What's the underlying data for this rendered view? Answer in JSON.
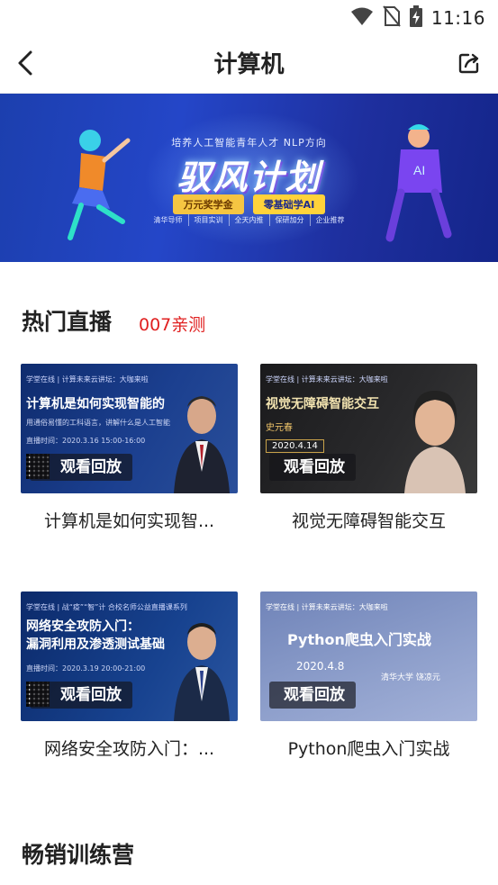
{
  "status_bar": {
    "time": "11:16",
    "icons": [
      "wifi-icon",
      "no-sim-icon",
      "battery-charging-icon"
    ]
  },
  "app_bar": {
    "title": "计算机",
    "back_icon": "chevron-left-icon",
    "share_icon": "share-icon"
  },
  "banner": {
    "subtitle": "培养人工智能青年人才 NLP方向",
    "title": "驭风计划",
    "badge_prize": "万元奖学金",
    "badge_free": "零基础学AI",
    "tags": [
      "清华导师",
      "项目实训",
      "全天内推",
      "保研加分",
      "企业推荐"
    ]
  },
  "hot_live": {
    "title": "热门直播",
    "note": "007亲测",
    "play_label": "观看回放",
    "cards": [
      {
        "thumb_header": "学堂在线  |  计算未来云讲坛：大咖来啦",
        "thumb_title": "计算机是如何实现智能的",
        "thumb_sub1": "用通俗易懂的工科语言，讲解什么是人工智能",
        "thumb_sub2": "直播时间：2020.3.16 15:00-16:00",
        "title": "计算机是如何实现智..."
      },
      {
        "thumb_header": "学堂在线  |  计算未来云讲坛：大咖来啦",
        "thumb_title": "视觉无障碍智能交互",
        "thumb_sub1": "史元春",
        "thumb_sub2": "2020.4.14",
        "title": "视觉无障碍智能交互"
      },
      {
        "thumb_header": "学堂在线  |  战“疫”“智”计 合校名师公益直播课系列",
        "thumb_title": "网络安全攻防入门：",
        "thumb_title2": "漏洞利用及渗透测试基础",
        "thumb_sub2": "直播时间：2020.3.19 20:00-21:00",
        "title": "网络安全攻防入门：..."
      },
      {
        "thumb_header": "学堂在线  |  计算未来云讲坛：大咖来啦",
        "thumb_title": "Python爬虫入门实战",
        "thumb_sub1": "2020.4.8",
        "thumb_sub2": "清华大学 饶凉元",
        "title": "Python爬虫入门实战"
      }
    ]
  },
  "bootcamp": {
    "title": "畅销训练营"
  },
  "colors": {
    "accent_red": "#e02020",
    "banner_blue": "#2446c8",
    "text": "#222222"
  }
}
